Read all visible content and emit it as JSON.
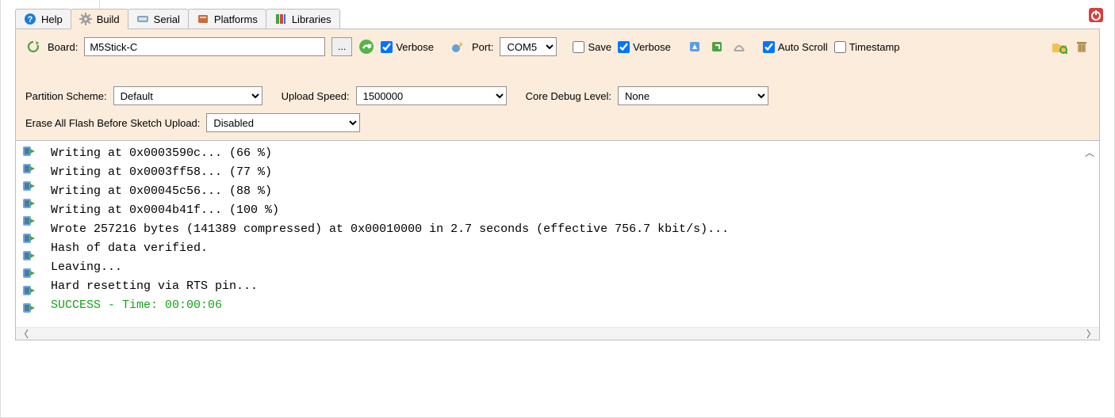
{
  "tabs": {
    "help": "Help",
    "build": "Build",
    "serial": "Serial",
    "platforms": "Platforms",
    "libraries": "Libraries",
    "active": "build"
  },
  "toolbar": {
    "board_label": "Board:",
    "board_value": "M5Stick-C",
    "ellipsis": "...",
    "verbose1": "Verbose",
    "port_label": "Port:",
    "port_value": "COM5",
    "save": "Save",
    "verbose2": "Verbose",
    "autoscroll": "Auto Scroll",
    "timestamp": "Timestamp"
  },
  "opts": {
    "partition_label": "Partition Scheme:",
    "partition_value": "Default",
    "speed_label": "Upload Speed:",
    "speed_value": "1500000",
    "debug_label": "Core Debug Level:",
    "debug_value": "None",
    "erase_label": "Erase All Flash Before Sketch Upload:",
    "erase_value": "Disabled"
  },
  "checks": {
    "verbose1": true,
    "save": false,
    "verbose2": true,
    "autoscroll": true,
    "timestamp": false
  },
  "log_lines": [
    {
      "t": "Writing at 0x0003590c... (66 %)",
      "c": ""
    },
    {
      "t": "Writing at 0x0003ff58... (77 %)",
      "c": ""
    },
    {
      "t": "Writing at 0x00045c56... (88 %)",
      "c": ""
    },
    {
      "t": "Writing at 0x0004b41f... (100 %)",
      "c": ""
    },
    {
      "t": "Wrote 257216 bytes (141389 compressed) at 0x00010000 in 2.7 seconds (effective 756.7 kbit/s)...",
      "c": ""
    },
    {
      "t": "Hash of data verified.",
      "c": ""
    },
    {
      "t": "",
      "c": ""
    },
    {
      "t": "Leaving...",
      "c": ""
    },
    {
      "t": "Hard resetting via RTS pin...",
      "c": ""
    },
    {
      "t": "SUCCESS - Time: 00:00:06",
      "c": "success"
    }
  ]
}
